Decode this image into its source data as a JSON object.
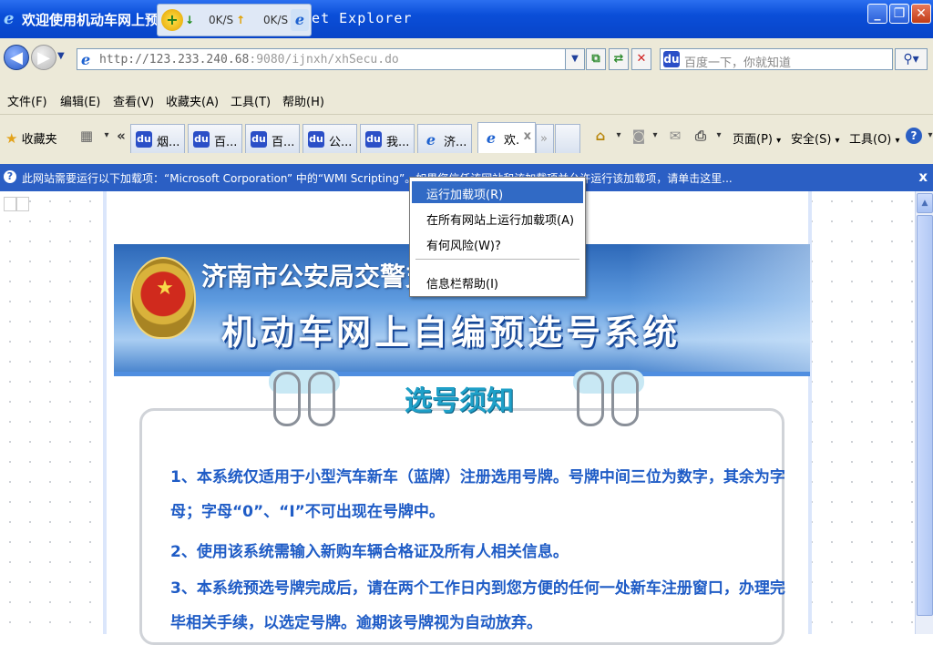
{
  "window": {
    "title": "欢迎使用机动车网上预选",
    "title_tail": "rnet Explorer"
  },
  "download": {
    "down_speed": "0K/S",
    "up_speed": "0K/S"
  },
  "address_bar": {
    "url_prefix": "http://123.233.240.68",
    "url_rest": ":9080/ijnxh/xhSecu.do",
    "search_placeholder": "百度一下，你就知道"
  },
  "menu": [
    "文件(F)",
    "编辑(E)",
    "查看(V)",
    "收藏夹(A)",
    "工具(T)",
    "帮助(H)"
  ],
  "tabs_toolbar": {
    "favorites": "收藏夹",
    "tabs": [
      "烟...",
      "百...",
      "百...",
      "公...",
      "我...",
      "济...",
      "欢."
    ],
    "page_menu": "页面(P)",
    "safety_menu": "安全(S)",
    "tools_menu": "工具(O)"
  },
  "infobar": {
    "text": "此网站需要运行以下加载项：“Microsoft Corporation” 中的“WMI Scripting”。如果您信任该网站和该加载项并允许运行该加载项，请单击这里..."
  },
  "context_menu": [
    "运行加载项(R)",
    "在所有网站上运行加载项(A)",
    "有何风险(W)?",
    "信息栏帮助(I)"
  ],
  "banner": {
    "line1": "济南市公安局交警支队",
    "line2": "机动车网上自编预选号系统"
  },
  "notice": {
    "title": "选号须知",
    "lines": [
      "1、本系统仅适用于小型汽车新车（蓝牌）注册选用号牌。号牌中间三位为数字，其余为字",
      "母；字母“0”、“I”不可出现在号牌中。",
      "2、使用该系统需输入新购车辆合格证及所有人相关信息。",
      "3、本系统预选号牌完成后，请在两个工作日内到您方便的任何一处新车注册窗口，办理完",
      "毕相关手续，以选定号牌。逾期该号牌视为自动放弃。"
    ]
  }
}
